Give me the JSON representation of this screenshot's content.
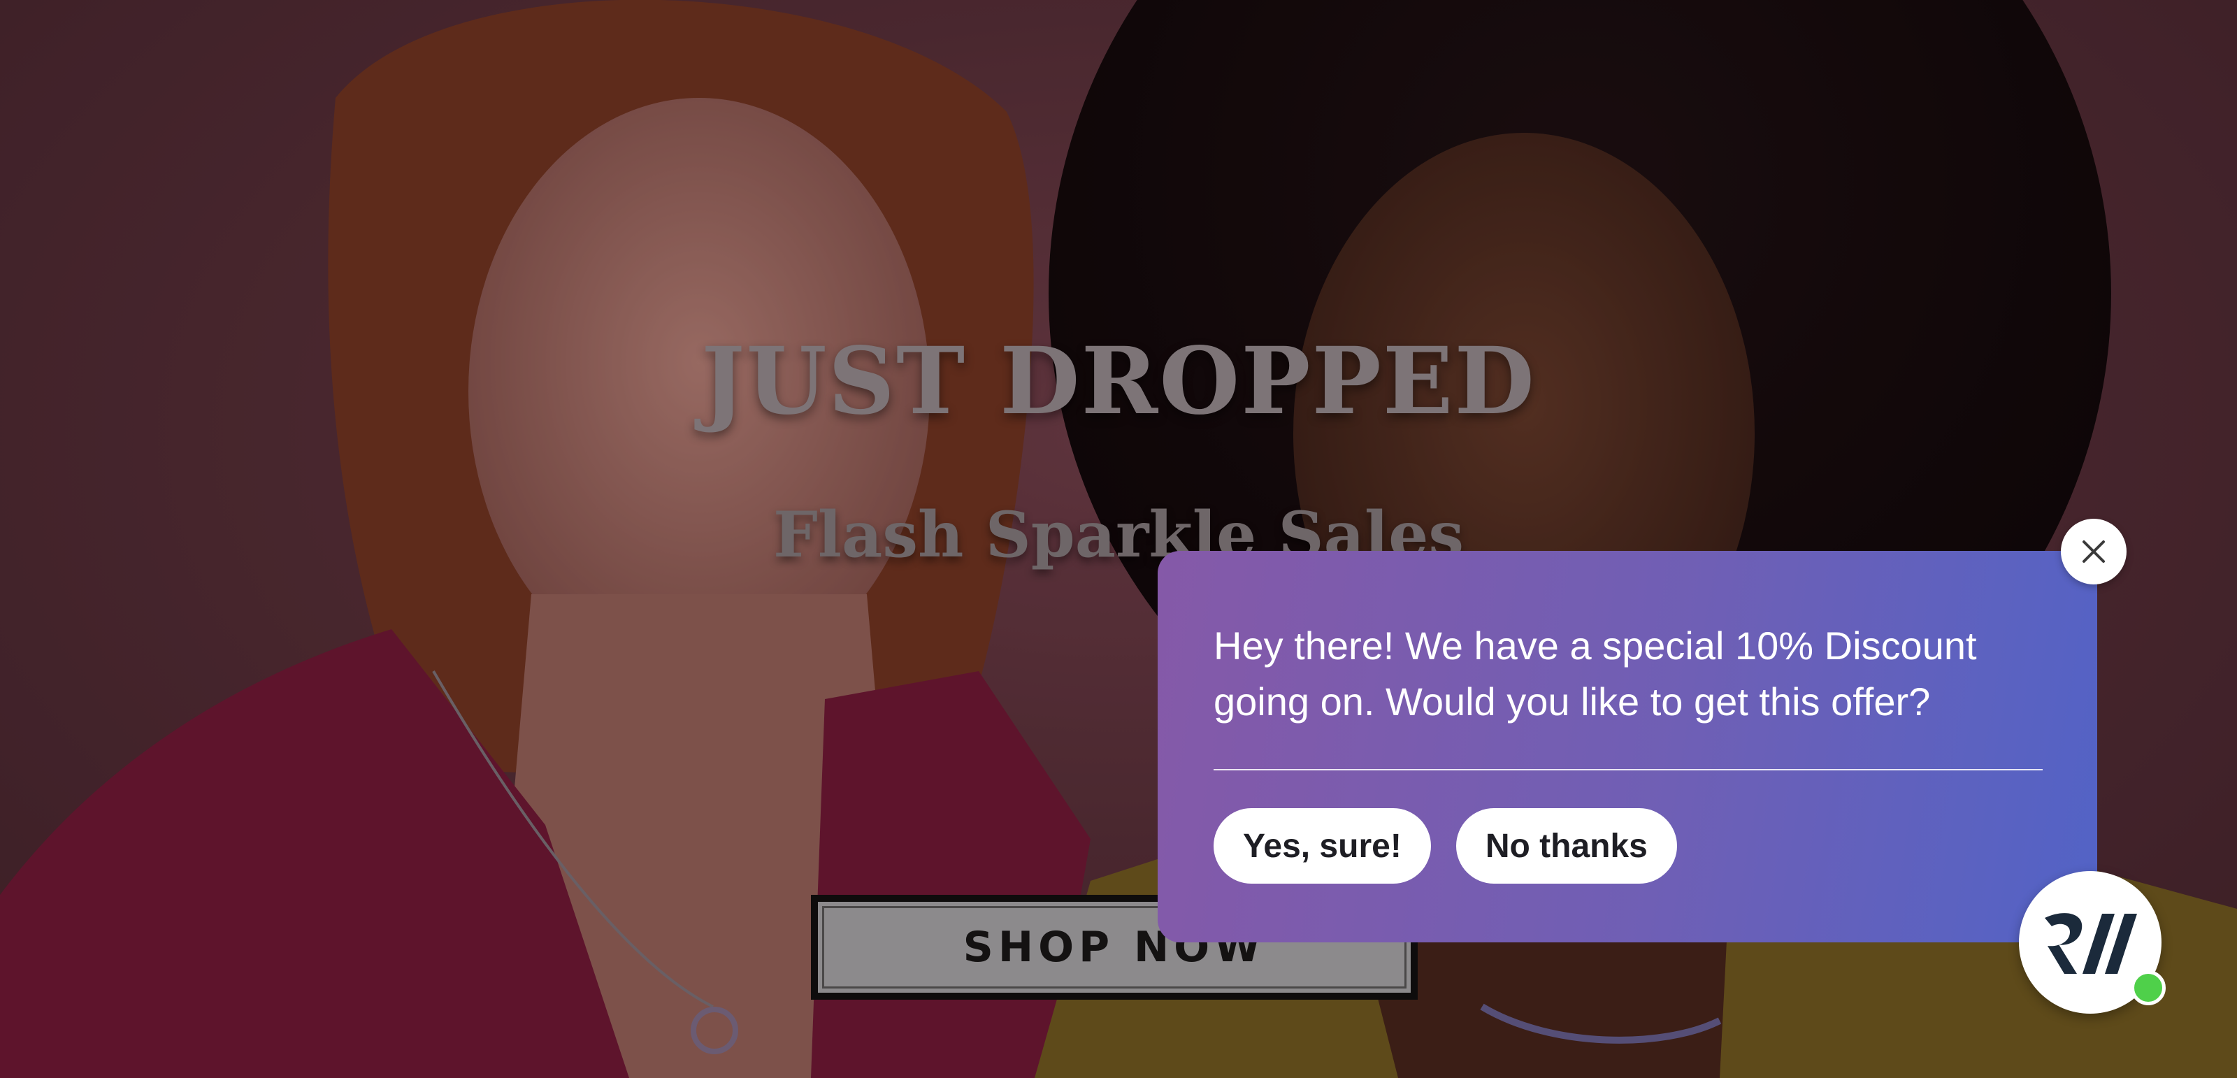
{
  "hero": {
    "title": "JUST DROPPED",
    "subtitle": "Flash Sparkle Sales",
    "cta_label": "SHOP NOW"
  },
  "popup": {
    "message": "Hey there! We have a special 10% Discount going on. Would you like to get this offer?",
    "accept_label": "Yes, sure!",
    "decline_label": "No thanks",
    "gradient_start": "#8559a8",
    "gradient_end": "#5263c6"
  },
  "icons": {
    "close": "close-icon",
    "chat_logo": "brand-logo-icon",
    "status": "online-status-dot"
  },
  "colors": {
    "online": "#4fd04a",
    "backdrop": "#5e343d"
  }
}
